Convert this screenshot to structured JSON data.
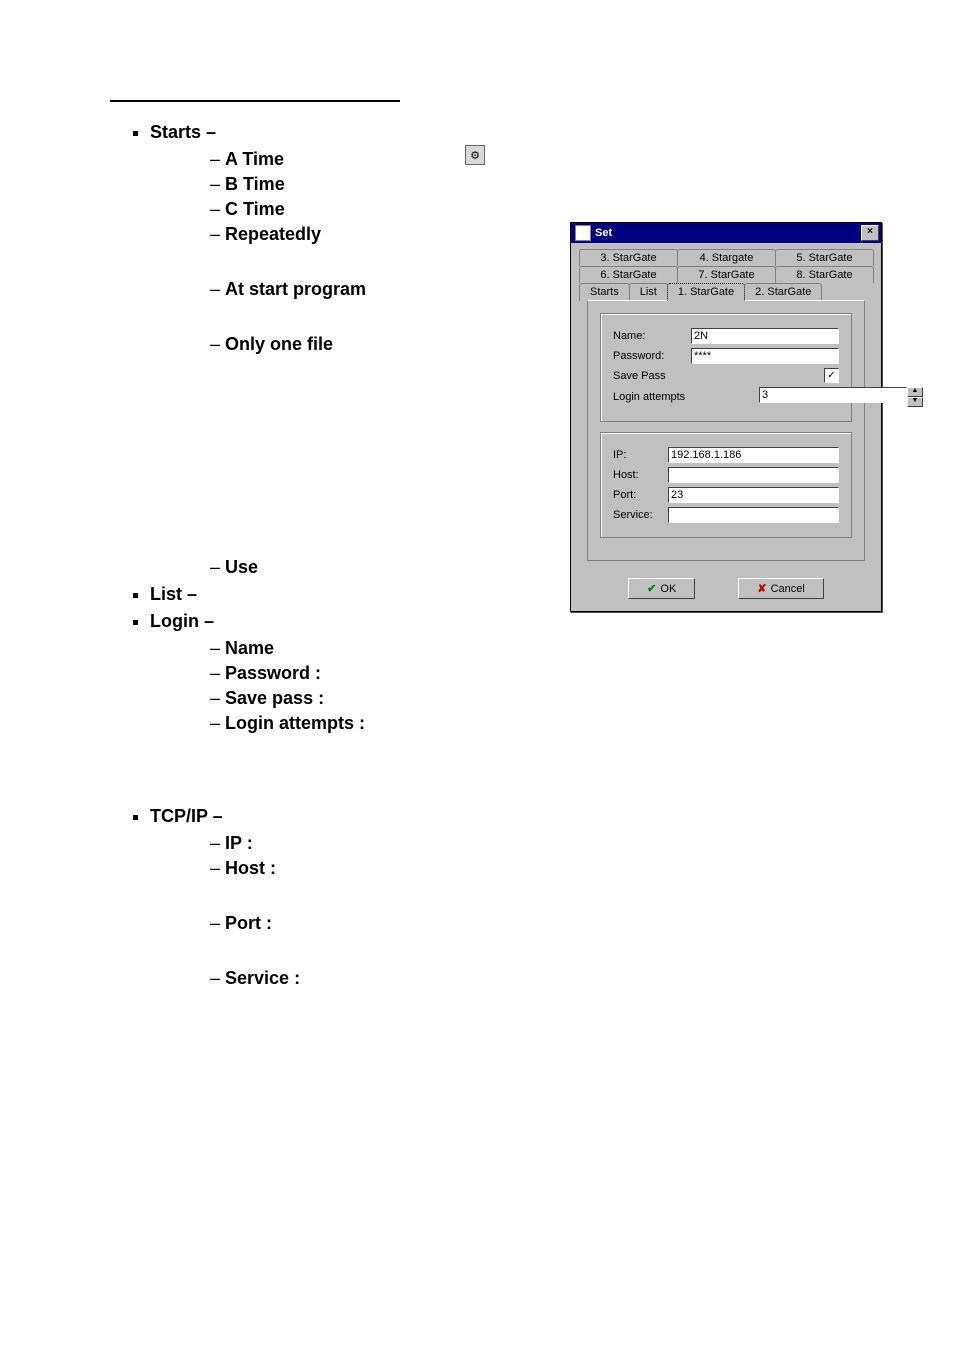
{
  "doc": {
    "items": {
      "starts": "Starts –",
      "starts_sub": {
        "a": "A Time",
        "b": "B Time",
        "c": "C Time",
        "rep": "Repeatedly",
        "atstart": " At start program",
        "onefile": "Only one file",
        "use": "Use"
      },
      "list": "List –",
      "login": "Login –",
      "login_sub": {
        "name": "Name",
        "password": "Password :",
        "savepass": "Save pass :",
        "attempts": "Login attempts :"
      },
      "tcpip": "TCP/IP –",
      "tcp_sub": {
        "ip": "IP :",
        "host": "Host :",
        "port": "Port  :",
        "service": "Service :"
      }
    }
  },
  "dialog": {
    "title": "Set",
    "close": "×",
    "tabs_row1": [
      "3. StarGate",
      "4. Stargate",
      "5. StarGate"
    ],
    "tabs_row2": [
      "6. StarGate",
      "7. StarGate",
      "8. StarGate"
    ],
    "tabs_row3": [
      "Starts",
      "List",
      "1. StarGate",
      "2. StarGate"
    ],
    "labels": {
      "name": "Name:",
      "password": "Password:",
      "savepass": "Save Pass",
      "attempts": "Login attempts",
      "ip": "IP:",
      "host": "Host:",
      "port": "Port:",
      "service": "Service:"
    },
    "values": {
      "name": "2N",
      "password": "****",
      "savepass": "✓",
      "attempts": "3",
      "ip": "192.168.1.186",
      "host": "",
      "port": "23",
      "service": ""
    },
    "buttons": {
      "ok": "OK",
      "cancel": "Cancel"
    }
  }
}
